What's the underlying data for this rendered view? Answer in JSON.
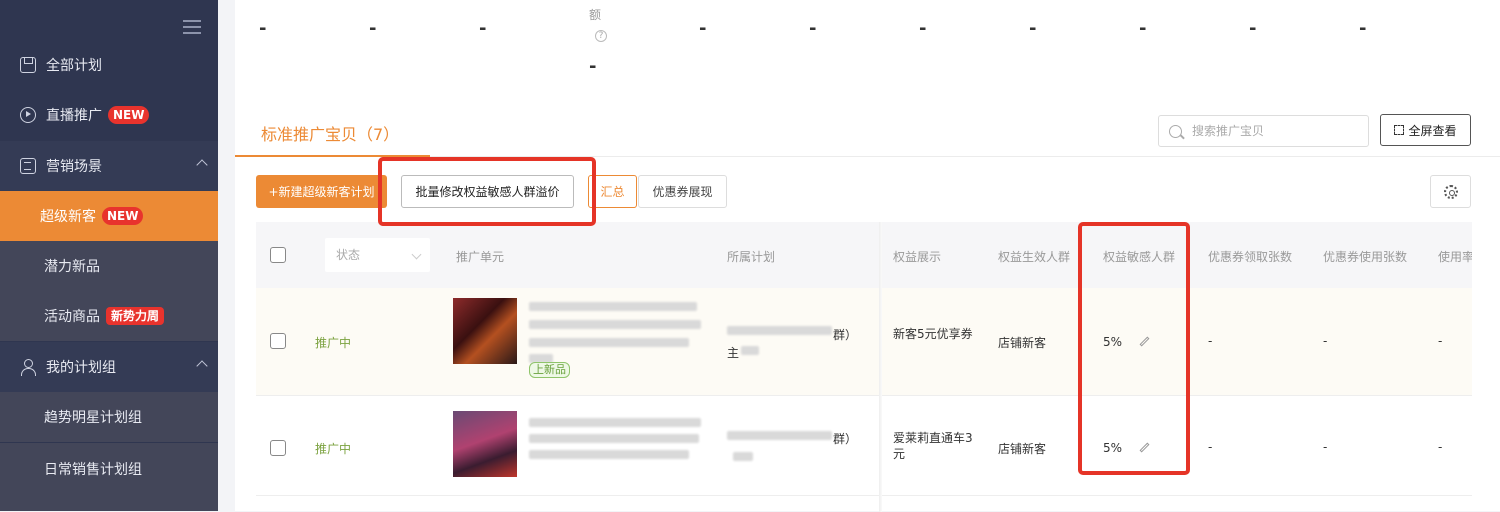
{
  "sidebar": {
    "items": [
      {
        "label": "全部计划",
        "icon": "save-icon"
      },
      {
        "label": "直播推广",
        "icon": "play-icon",
        "badge": "NEW"
      },
      {
        "label": "营销场景",
        "icon": "list-icon"
      },
      {
        "label": "超级新客",
        "badge": "NEW"
      },
      {
        "label": "潜力新品"
      },
      {
        "label": "活动商品",
        "badge": "新势力周"
      },
      {
        "label": "我的计划组",
        "icon": "user-icon"
      },
      {
        "label": "趋势明星计划组"
      },
      {
        "label": "日常销售计划组"
      }
    ]
  },
  "metrics": {
    "extra_label": "额",
    "values": [
      "-",
      "-",
      "-",
      "-",
      "-",
      "-",
      "-",
      "-",
      "-",
      "-",
      "-"
    ]
  },
  "section": {
    "title": "标准推广宝贝（7）",
    "search_placeholder": "搜索推广宝贝",
    "fullscreen_label": "全屏查看"
  },
  "toolbar": {
    "new_plan_label": "+新建超级新客计划",
    "batch_edit_label": "批量修改权益敏感人群溢价",
    "summary_label": "汇总",
    "coupon_label": "优惠券展现"
  },
  "table": {
    "headers": {
      "status": "状态",
      "unit": "推广单元",
      "plan": "所属计划",
      "benefit": "权益展示",
      "effective": "权益生效人群",
      "sensitive": "权益敏感人群",
      "coupon_claimed": "优惠券领取张数",
      "coupon_used": "优惠券使用张数",
      "usage": "使用率"
    },
    "rows": [
      {
        "status": "推广中",
        "tag": "上新品",
        "plan_suffix": "群）",
        "plan_line2": "主",
        "benefit": "新客5元优享券",
        "effective": "店铺新客",
        "sensitive": "5%",
        "claimed": "-",
        "used": "-",
        "rate": "-"
      },
      {
        "status": "推广中",
        "plan_suffix": "群）",
        "benefit": "爱莱莉直通车3元",
        "effective": "店铺新客",
        "sensitive": "5%",
        "claimed": "-",
        "used": "-",
        "rate": "-"
      }
    ]
  },
  "colors": {
    "accent": "#ec8a35",
    "sidebar_bg": "#2f3650",
    "highlight_box": "#e53427",
    "status_active": "#7ba23f"
  }
}
